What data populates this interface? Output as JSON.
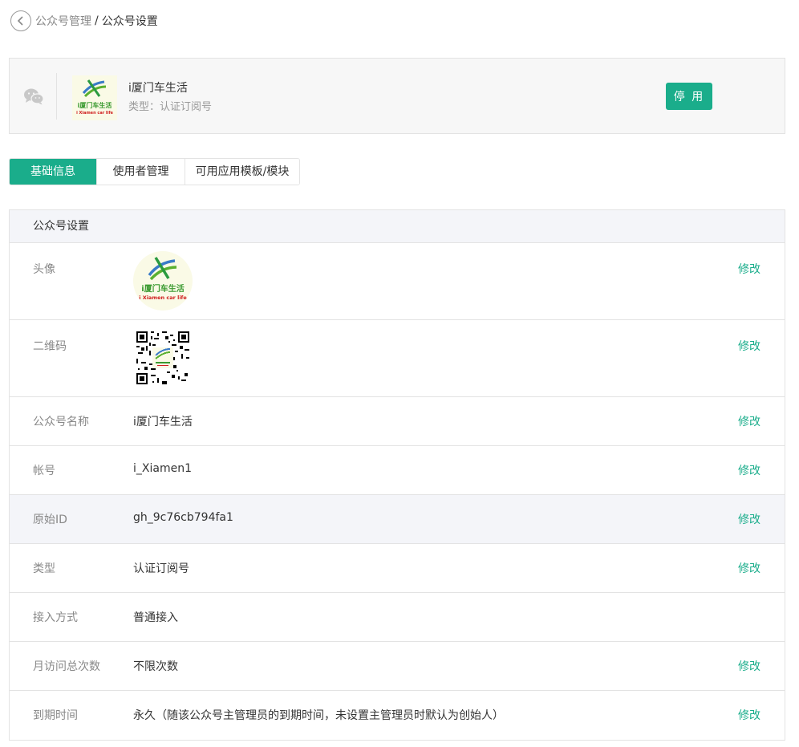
{
  "breadcrumb": {
    "parent": "公众号管理",
    "separator": "/",
    "current": "公众号设置"
  },
  "account": {
    "name": "i厦门车生活",
    "type_text": "类型：认证订阅号",
    "disable_label": "停 用",
    "logo": {
      "cn_text": "i厦门车生活",
      "en_text": "i Xiamen car life"
    }
  },
  "tabs": [
    {
      "label": "基础信息",
      "active": true
    },
    {
      "label": "使用者管理",
      "active": false
    },
    {
      "label": "可用应用模板/模块",
      "active": false
    }
  ],
  "panel": {
    "title": "公众号设置",
    "rows": [
      {
        "label": "头像",
        "value": "",
        "kind": "avatar",
        "edit": "修改"
      },
      {
        "label": "二维码",
        "value": "",
        "kind": "qr",
        "edit": "修改"
      },
      {
        "label": "公众号名称",
        "value": "i厦门车生活",
        "kind": "text",
        "edit": "修改"
      },
      {
        "label": "帐号",
        "value": "i_Xiamen1",
        "kind": "text",
        "edit": "修改"
      },
      {
        "label": "原始ID",
        "value": "gh_9c76cb794fa1",
        "kind": "text",
        "edit": "修改"
      },
      {
        "label": "类型",
        "value": "认证订阅号",
        "kind": "text",
        "edit": "修改"
      },
      {
        "label": "接入方式",
        "value": "普通接入",
        "kind": "text",
        "edit": ""
      },
      {
        "label": "月访问总次数",
        "value": "不限次数",
        "kind": "text",
        "edit": "修改"
      },
      {
        "label": "到期时间",
        "value": "永久（随该公众号主管理员的到期时间，未设置主管理员时默认为创始人）",
        "kind": "text",
        "edit": "修改"
      }
    ]
  },
  "colors": {
    "accent": "#1aad8b",
    "panel_header_bg": "#f4f5f9",
    "card_bg": "#f7f7f7",
    "border": "#e3e3e3"
  },
  "icons": {
    "back": "chevron-left-circle-icon",
    "wechat": "wechat-icon"
  }
}
